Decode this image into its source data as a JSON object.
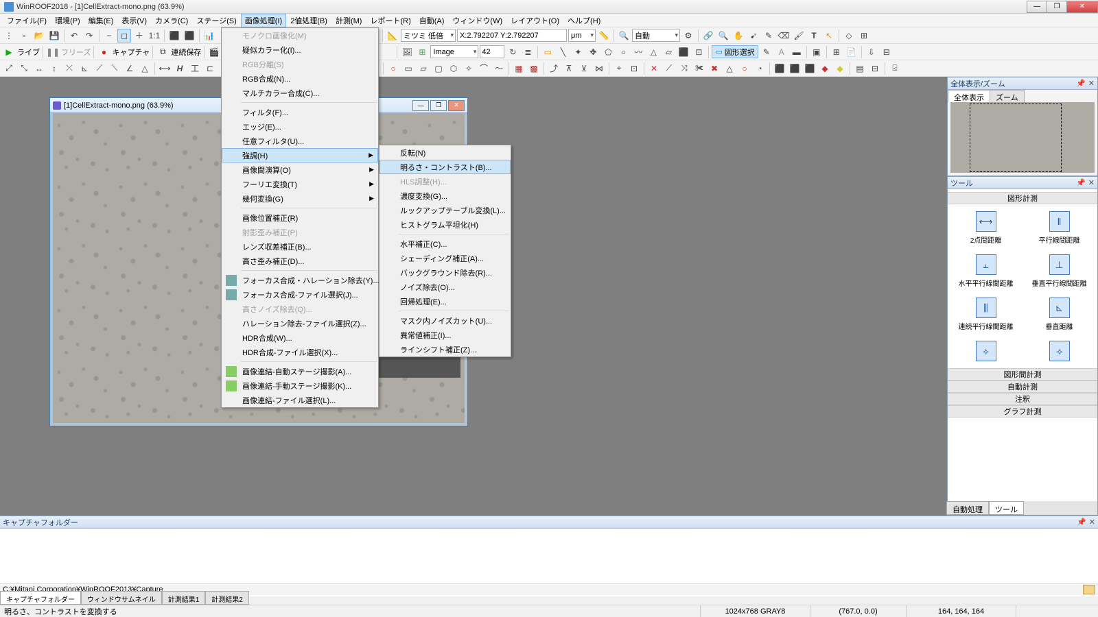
{
  "title": "WinROOF2018 - [1]CellExtract-mono.png (63.9%)",
  "menus": [
    "ファイル(F)",
    "環境(P)",
    "編集(E)",
    "表示(V)",
    "カメラ(C)",
    "ステージ(S)",
    "画像処理(I)",
    "2値処理(B)",
    "計測(M)",
    "レポート(R)",
    "自動(A)",
    "ウィンドウ(W)",
    "レイアウト(O)",
    "ヘルプ(H)"
  ],
  "open_menu_index": 6,
  "tb1": {
    "live": "ライブ",
    "freeze": "フリーズ",
    "capture": "キャプチャ",
    "seq": "連続保存",
    "movie": "動画"
  },
  "tb2": {
    "lens": "ミツミ 低倍",
    "coord": "X:2.792207 Y:2.792207",
    "unit": "μm",
    "auto": "自動",
    "image": "Image",
    "imgnum": "42",
    "shapesel": "図形選択"
  },
  "dropdown1": [
    {
      "t": "モノクロ画像化(M)",
      "d": true
    },
    {
      "t": "疑似カラー化(I)..."
    },
    {
      "t": "RGB分離(S)",
      "d": true
    },
    {
      "t": "RGB合成(N)..."
    },
    {
      "t": "マルチカラー合成(C)..."
    },
    {
      "sep": true
    },
    {
      "t": "フィルタ(F)..."
    },
    {
      "t": "エッジ(E)..."
    },
    {
      "t": "任意フィルタ(U)..."
    },
    {
      "t": "強調(H)",
      "sub": true,
      "hl": true
    },
    {
      "t": "画像間演算(O)",
      "sub": true
    },
    {
      "t": "フーリエ変換(T)",
      "sub": true
    },
    {
      "t": "幾何変換(G)",
      "sub": true
    },
    {
      "sep": true
    },
    {
      "t": "画像位置補正(R)"
    },
    {
      "t": "射影歪み補正(P)",
      "d": true
    },
    {
      "t": "レンズ収差補正(B)..."
    },
    {
      "t": "高さ歪み補正(D)..."
    },
    {
      "sep": true
    },
    {
      "t": "フォーカス合成・ハレーション除去(Y)...",
      "ico": "#7aa"
    },
    {
      "t": "フォーカス合成-ファイル選択(J)...",
      "ico": "#7aa"
    },
    {
      "t": "高さノイズ除去(Q)...",
      "d": true
    },
    {
      "t": "ハレーション除去-ファイル選択(Z)..."
    },
    {
      "t": "HDR合成(W)..."
    },
    {
      "t": "HDR合成-ファイル選択(X)..."
    },
    {
      "sep": true
    },
    {
      "t": "画像連結-自動ステージ撮影(A)...",
      "ico": "#8c6"
    },
    {
      "t": "画像連結-手動ステージ撮影(K)...",
      "ico": "#8c6"
    },
    {
      "t": "画像連結-ファイル選択(L)..."
    }
  ],
  "dropdown2": [
    {
      "t": "反転(N)"
    },
    {
      "t": "明るさ・コントラスト(B)...",
      "hl": true
    },
    {
      "t": "HLS調整(H)...",
      "d": true
    },
    {
      "t": "濃度変換(G)..."
    },
    {
      "t": "ルックアップテーブル変換(L)..."
    },
    {
      "t": "ヒストグラム平坦化(H)"
    },
    {
      "sep": true
    },
    {
      "t": "水平補正(C)..."
    },
    {
      "t": "シェーディング補正(A)..."
    },
    {
      "t": "バックグラウンド除去(R)..."
    },
    {
      "t": "ノイズ除去(O)..."
    },
    {
      "t": "回帰処理(E)..."
    },
    {
      "sep": true
    },
    {
      "t": "マスク内ノイズカット(U)..."
    },
    {
      "t": "異常値補正(I)..."
    },
    {
      "t": "ラインシフト補正(Z)..."
    }
  ],
  "child": {
    "title": "[1]CellExtract-mono.png (63.9%)"
  },
  "overview": {
    "title": "全体表示/ズーム",
    "tab1": "全体表示",
    "tab2": "ズーム"
  },
  "toolpanel": {
    "title": "ツール",
    "head1": "図形計測",
    "items": [
      "2点間距離",
      "平行線間距離",
      "水平平行線間距離",
      "垂直平行線間距離",
      "連続平行線間距離",
      "垂直距離"
    ],
    "head2": "図形間計測",
    "head3": "自動計測",
    "head4": "注釈",
    "head5": "グラフ計測",
    "btab1": "自動処理",
    "btab2": "ツール"
  },
  "capture": {
    "title": "キャプチャフォルダー",
    "path": "C:¥Mitani Corporation¥WinROOF2013¥Capture",
    "tabs": [
      "キャプチャフォルダー",
      "ウィンドウサムネイル",
      "計測結果1",
      "計測結果2"
    ]
  },
  "status": {
    "msg": "明るさ、コントラストを変換する",
    "size": "1024x768 GRAY8",
    "pos": "(767.0, 0.0)",
    "val": "164, 164, 164"
  }
}
